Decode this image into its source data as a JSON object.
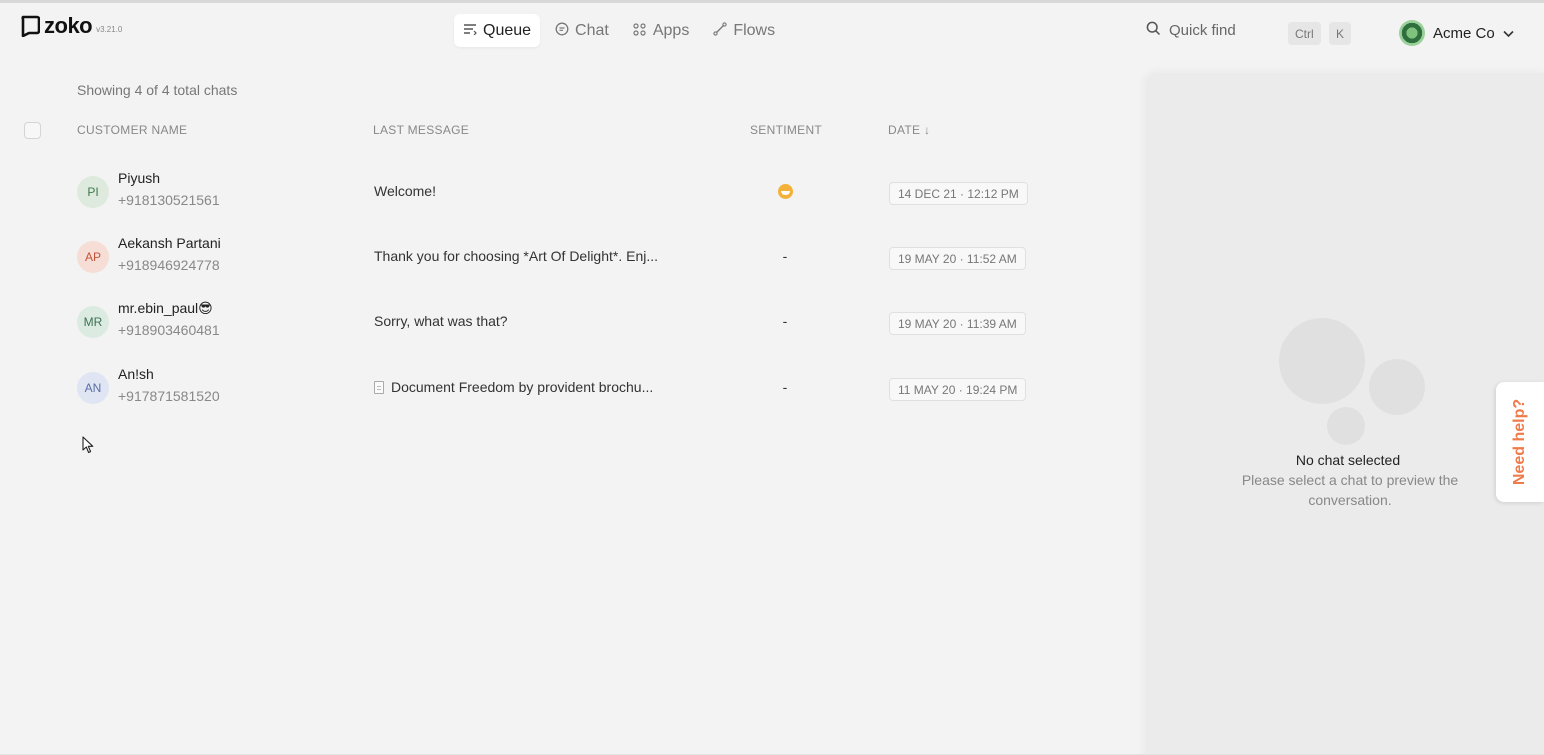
{
  "brand": {
    "name": "zoko",
    "version": "v3.21.0"
  },
  "nav": [
    {
      "label": "Queue",
      "icon": "queue-icon",
      "active": true
    },
    {
      "label": "Chat",
      "icon": "chat-icon",
      "active": false
    },
    {
      "label": "Apps",
      "icon": "apps-icon",
      "active": false
    },
    {
      "label": "Flows",
      "icon": "flows-icon",
      "active": false
    }
  ],
  "search": {
    "label": "Quick find",
    "shortcut_keys": [
      "Ctrl",
      "K"
    ]
  },
  "account": {
    "name": "Acme Co"
  },
  "list": {
    "count_label": "Showing 4 of 4 total chats",
    "columns": {
      "customer": "CUSTOMER NAME",
      "last_message": "LAST MESSAGE",
      "sentiment": "SENTIMENT",
      "date": "DATE ↓"
    },
    "rows": [
      {
        "initials": "PI",
        "name": "Piyush",
        "phone": "+918130521561",
        "last_message": "Welcome!",
        "sentiment": "smiley",
        "date": "14 DEC 21 · 12:12 PM",
        "avatar_bg": "#dfeadf",
        "avatar_fg": "#3f7a4d"
      },
      {
        "initials": "AP",
        "name": "Aekansh Partani",
        "phone": "+918946924778",
        "last_message": "Thank you for choosing *Art Of Delight*. Enj...",
        "sentiment": "-",
        "date": "19 MAY 20 · 11:52 AM",
        "avatar_bg": "#f6ddd6",
        "avatar_fg": "#c0553a"
      },
      {
        "initials": "MR",
        "name": "mr.ebin_paul😎",
        "phone": "+918903460481",
        "last_message": "Sorry, what was that?",
        "sentiment": "-",
        "date": "19 MAY 20 · 11:39 AM",
        "avatar_bg": "#dcebe2",
        "avatar_fg": "#3e7153"
      },
      {
        "initials": "AN",
        "name": "An!sh",
        "phone": "+917871581520",
        "last_message": "Document Freedom by provident brochu...",
        "has_document": true,
        "sentiment": "-",
        "date": "11 MAY 20 · 19:24 PM",
        "avatar_bg": "#dfe5f3",
        "avatar_fg": "#5b6fa6"
      }
    ]
  },
  "preview": {
    "empty_title": "No chat selected",
    "empty_subtitle": "Please select a chat to preview the conversation."
  },
  "help": {
    "label": "Need help?"
  },
  "colors": {
    "accent": "#f07a4a",
    "background": "#f3f3f3",
    "panel": "#ebebeb"
  }
}
